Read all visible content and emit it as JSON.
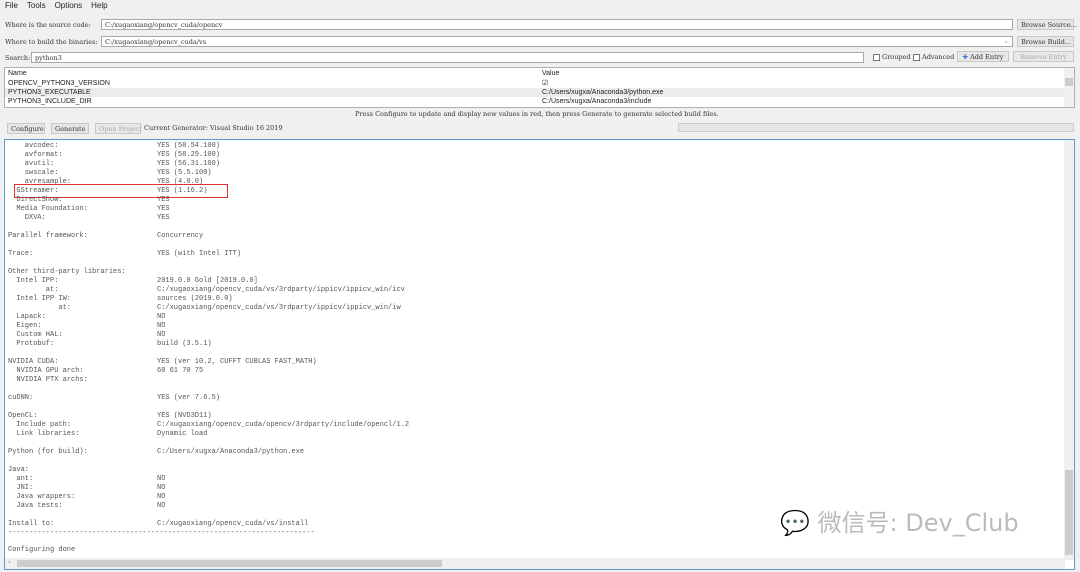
{
  "menu": [
    "File",
    "Tools",
    "Options",
    "Help"
  ],
  "source": {
    "label": "Where is the source code:",
    "value": "C:/xugaoxiang/opencv_cuda/opencv",
    "button": "Browse Source..."
  },
  "build": {
    "label": "Where to build the binaries:",
    "value": "C:/xugaoxiang/opencv_cuda/vs",
    "button": "Browse Build..."
  },
  "search": {
    "label": "Search:",
    "value": "python3"
  },
  "options": {
    "grouped": "Grouped",
    "advanced": "Advanced",
    "add_entry": "Add Entry",
    "remove_entry": "Remove Entry"
  },
  "table": {
    "headers": [
      "Name",
      "Value"
    ],
    "rows": [
      {
        "name": "OPENCV_PYTHON3_VERSION",
        "value": "☑"
      },
      {
        "name": "PYTHON3_EXECUTABLE",
        "value": "C:/Users/xugxa/Anaconda3/python.exe"
      },
      {
        "name": "PYTHON3_INCLUDE_DIR",
        "value": "C:/Users/xugxa/Anaconda3/include"
      }
    ]
  },
  "hint": "Press Configure to update and display new values in red, then press Generate to generate selected build files.",
  "actions": {
    "configure": "Configure",
    "generate": "Generate",
    "open_project": "Open Project",
    "generator": "Current Generator: Visual Studio 16 2019"
  },
  "log": [
    [
      "    avcodec:",
      "YES (58.54.100)"
    ],
    [
      "    avformat:",
      "YES (58.29.100)"
    ],
    [
      "    avutil:",
      "YES (56.31.100)"
    ],
    [
      "    swscale:",
      "YES (5.5.100)"
    ],
    [
      "    avresample:",
      "YES (4.0.0)"
    ],
    [
      "  GStreamer:",
      "YES (1.16.2)"
    ],
    [
      "  DirectShow:",
      "YES"
    ],
    [
      "  Media Foundation:",
      "YES"
    ],
    [
      "    DXVA:",
      "YES"
    ],
    [
      "",
      ""
    ],
    [
      "Parallel framework:",
      "Concurrency"
    ],
    [
      "",
      ""
    ],
    [
      "Trace:",
      "YES (with Intel ITT)"
    ],
    [
      "",
      ""
    ],
    [
      "Other third-party libraries:",
      ""
    ],
    [
      "  Intel IPP:",
      "2019.0.0 Gold [2019.0.0]"
    ],
    [
      "         at:",
      "C:/xugaoxiang/opencv_cuda/vs/3rdparty/ippicv/ippicv_win/icv"
    ],
    [
      "  Intel IPP IW:",
      "sources (2019.0.0)"
    ],
    [
      "            at:",
      "C:/xugaoxiang/opencv_cuda/vs/3rdparty/ippicv/ippicv_win/iw"
    ],
    [
      "  Lapack:",
      "NO"
    ],
    [
      "  Eigen:",
      "NO"
    ],
    [
      "  Custom HAL:",
      "NO"
    ],
    [
      "  Protobuf:",
      "build (3.5.1)"
    ],
    [
      "",
      ""
    ],
    [
      "NVIDIA CUDA:",
      "YES (ver 10.2, CUFFT CUBLAS FAST_MATH)"
    ],
    [
      "  NVIDIA GPU arch:",
      "60 61 70 75"
    ],
    [
      "  NVIDIA PTX archs:",
      ""
    ],
    [
      "",
      ""
    ],
    [
      "cuDNN:",
      "YES (ver 7.6.5)"
    ],
    [
      "",
      ""
    ],
    [
      "OpenCL:",
      "YES (NVD3D11)"
    ],
    [
      "  Include path:",
      "C:/xugaoxiang/opencv_cuda/opencv/3rdparty/include/opencl/1.2"
    ],
    [
      "  Link libraries:",
      "Dynamic load"
    ],
    [
      "",
      ""
    ],
    [
      "Python (for build):",
      "C:/Users/xugxa/Anaconda3/python.exe"
    ],
    [
      "",
      ""
    ],
    [
      "Java:",
      ""
    ],
    [
      "  ant:",
      "NO"
    ],
    [
      "  JNI:",
      "NO"
    ],
    [
      "  Java wrappers:",
      "NO"
    ],
    [
      "  Java tests:",
      "NO"
    ],
    [
      "",
      ""
    ],
    [
      "Install to:",
      "C:/xugaoxiang/opencv_cuda/vs/install"
    ],
    [
      "-------------------------------------------------------------------------",
      ""
    ],
    [
      "",
      ""
    ]
  ],
  "status_line": "Configuring done",
  "watermark": "微信号: Dev_Club"
}
